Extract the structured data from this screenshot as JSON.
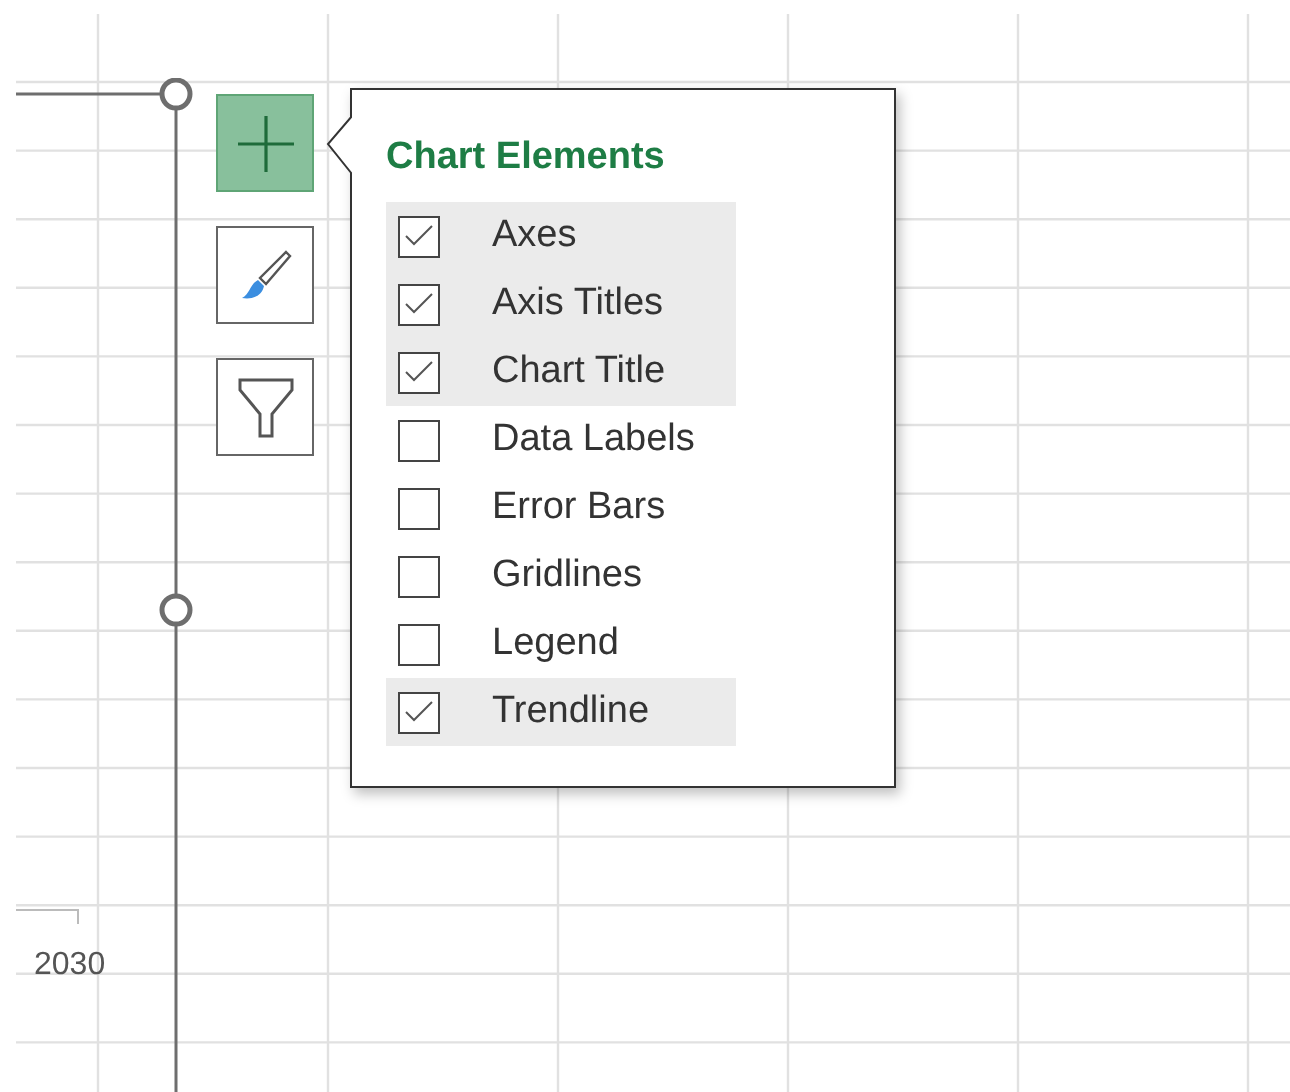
{
  "chart": {
    "axis_label": "2030"
  },
  "popup": {
    "title": "Chart Elements",
    "items": [
      {
        "label": "Axes",
        "checked": true
      },
      {
        "label": "Axis Titles",
        "checked": true
      },
      {
        "label": "Chart Title",
        "checked": true
      },
      {
        "label": "Data Labels",
        "checked": false
      },
      {
        "label": "Error Bars",
        "checked": false
      },
      {
        "label": "Gridlines",
        "checked": false
      },
      {
        "label": "Legend",
        "checked": false
      },
      {
        "label": "Trendline",
        "checked": true
      }
    ]
  }
}
